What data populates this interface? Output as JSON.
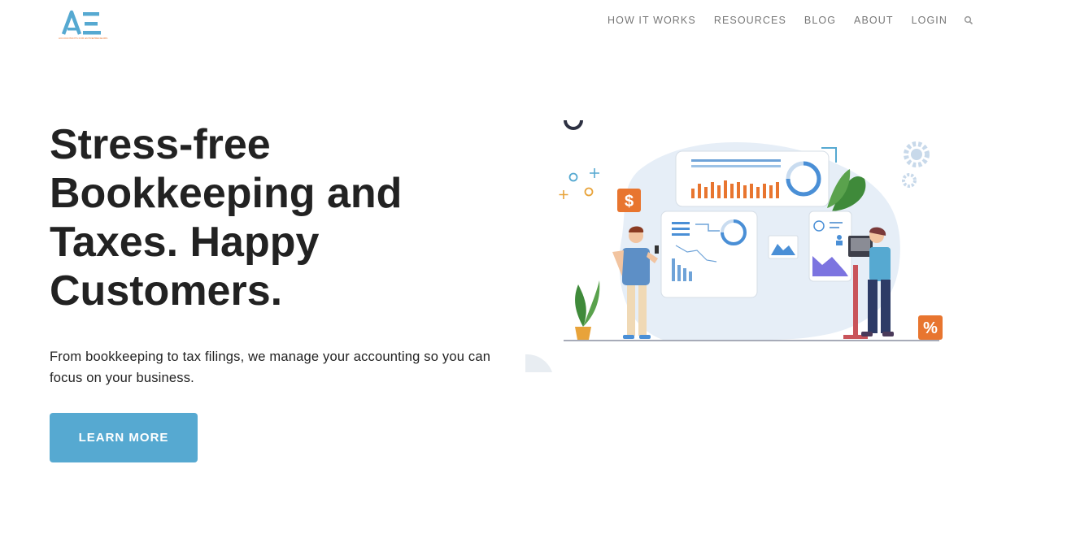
{
  "brand": {
    "logo_text": "AE",
    "tagline": "ACCOUNTANTS FOR ENTREPRENEURS",
    "colors": {
      "primary": "#56a9d1",
      "accent": "#e8752f"
    }
  },
  "nav": {
    "items": [
      {
        "label": "HOW IT WORKS"
      },
      {
        "label": "RESOURCES"
      },
      {
        "label": "BLOG"
      },
      {
        "label": "ABOUT"
      },
      {
        "label": "LOGIN"
      }
    ],
    "search_icon": "search-icon"
  },
  "hero": {
    "title": "Stress-free Bookkeeping and Taxes. Happy Customers.",
    "subtitle": "From bookkeeping to tax filings, we manage your accounting so you can focus on your business.",
    "cta_label": "LEARN MORE",
    "illustration": {
      "dollar_badge": "$",
      "percent_badge": "%"
    }
  }
}
